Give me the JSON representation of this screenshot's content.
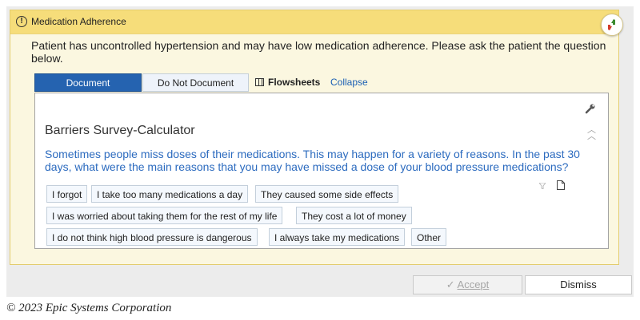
{
  "alert": {
    "title": "Medication Adherence",
    "message": "Patient has uncontrolled hypertension and may have low medication adherence. Please ask the patient the question below.",
    "icons": {
      "warning": "exclamation-circle-icon",
      "feedback": "thumbs-up-down-icon"
    }
  },
  "tabs": {
    "document": "Document",
    "do_not_document": "Do Not Document",
    "flowsheets": "Flowsheets",
    "collapse": "Collapse"
  },
  "survey": {
    "title": "Barriers Survey-Calculator",
    "question": "Sometimes people miss doses of their medications. This may happen for a variety of reasons. In the past 30 days, what were the main reasons that you may have missed a dose of your blood pressure medications?",
    "options": [
      "I forgot",
      "I take too many medications a day",
      "They caused some side effects",
      "I was worried about taking them for the rest of my life",
      "They cost a lot of money",
      "I do not think high blood pressure is dangerous",
      "I always take my medications",
      "Other"
    ]
  },
  "footer": {
    "accept": "Accept",
    "dismiss": "Dismiss"
  },
  "copyright": "© 2023 Epic Systems Corporation",
  "colors": {
    "header": "#f6dd7a",
    "accent": "#2563b0",
    "question_text": "#2c6bbf"
  }
}
